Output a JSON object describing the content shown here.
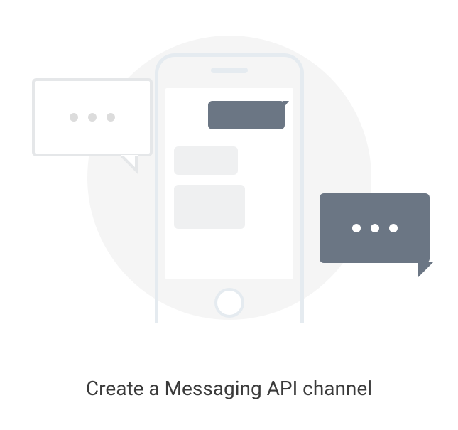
{
  "card": {
    "title": "Create a Messaging API channel"
  }
}
